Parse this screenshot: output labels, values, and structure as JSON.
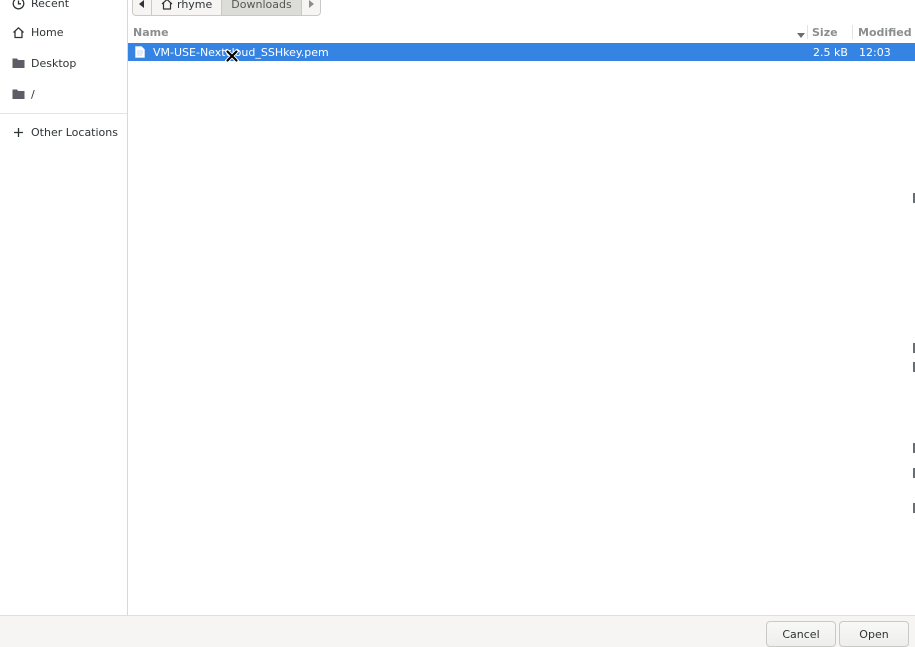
{
  "sidebar": {
    "items": [
      {
        "label": "Recent",
        "icon": "clock-icon"
      },
      {
        "label": "Home",
        "icon": "home-icon"
      },
      {
        "label": "Desktop",
        "icon": "folder-icon"
      },
      {
        "label": "/",
        "icon": "folder-icon"
      },
      {
        "label": "Other Locations",
        "icon": "plus-icon"
      }
    ]
  },
  "pathbar": {
    "segments": [
      "rhyme",
      "Downloads"
    ]
  },
  "columns": {
    "name": "Name",
    "size": "Size",
    "modified": "Modified"
  },
  "files": [
    {
      "name": "VM-USE-Nextcloud_SSHkey.pem",
      "size": "2.5 kB",
      "modified": "12:03",
      "selected": true
    }
  ],
  "footer": {
    "cancel_label": "Cancel",
    "open_label": "Open"
  },
  "colors": {
    "selection": "#3584e4",
    "sidebar_border": "#d8d8d5"
  }
}
